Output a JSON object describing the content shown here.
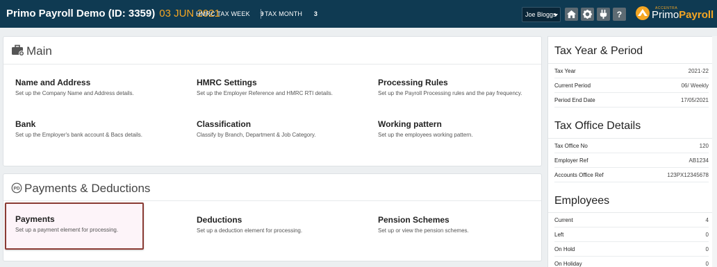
{
  "header": {
    "company": "Primo Payroll Demo (ID: 3359)",
    "date": "03 JUN 2021",
    "tax_week_label": "HMRC TAX WEEK",
    "tax_week_value": "9",
    "tax_month_label": "TAX MONTH",
    "tax_month_value": "3",
    "user": "Joe Bloggs",
    "icons": [
      "home-icon",
      "gear-icon",
      "plug-icon",
      "help-icon"
    ],
    "logo_small": "ACCENTRA",
    "logo_primary": "Primo",
    "logo_secondary": "Payroll",
    "colors": {
      "bar": "#0f3a52",
      "accent": "#f5a623"
    }
  },
  "main": {
    "title": "Main",
    "items": [
      {
        "title": "Name and Address",
        "desc": "Set up the Company Name and Address details."
      },
      {
        "title": "HMRC Settings",
        "desc": "Set up the Employer Reference and HMRC RTI details."
      },
      {
        "title": "Processing Rules",
        "desc": "Set up the Payroll Processing rules and the pay frequency."
      },
      {
        "title": "Bank",
        "desc": "Set up the Employer's bank account & Bacs details."
      },
      {
        "title": "Classification",
        "desc": "Classify by Branch, Department & Job Category."
      },
      {
        "title": "Working pattern",
        "desc": "Set up the employees working pattern."
      }
    ]
  },
  "payments": {
    "title": "Payments & Deductions",
    "items": [
      {
        "title": "Payments",
        "desc": "Set up a payment element for processing."
      },
      {
        "title": "Deductions",
        "desc": "Set up a deduction element for processing."
      },
      {
        "title": "Pension Schemes",
        "desc": "Set up or view the pension schemes."
      }
    ]
  },
  "sidebar": {
    "tax_year": {
      "title": "Tax Year & Period",
      "rows": [
        {
          "label": "Tax Year",
          "value": "2021-22"
        },
        {
          "label": "Current Period",
          "value": "06/ Weekly"
        },
        {
          "label": "Period End Date",
          "value": "17/05/2021"
        }
      ]
    },
    "tax_office": {
      "title": "Tax Office Details",
      "rows": [
        {
          "label": "Tax Office No",
          "value": "120"
        },
        {
          "label": "Employer Ref",
          "value": "AB1234"
        },
        {
          "label": "Accounts Office Ref",
          "value": "123PX12345678"
        }
      ]
    },
    "employees": {
      "title": "Employees",
      "rows": [
        {
          "label": "Current",
          "value": "4"
        },
        {
          "label": "Left",
          "value": "0"
        },
        {
          "label": "On Hold",
          "value": "0"
        },
        {
          "label": "On Holiday",
          "value": "0"
        }
      ]
    }
  }
}
